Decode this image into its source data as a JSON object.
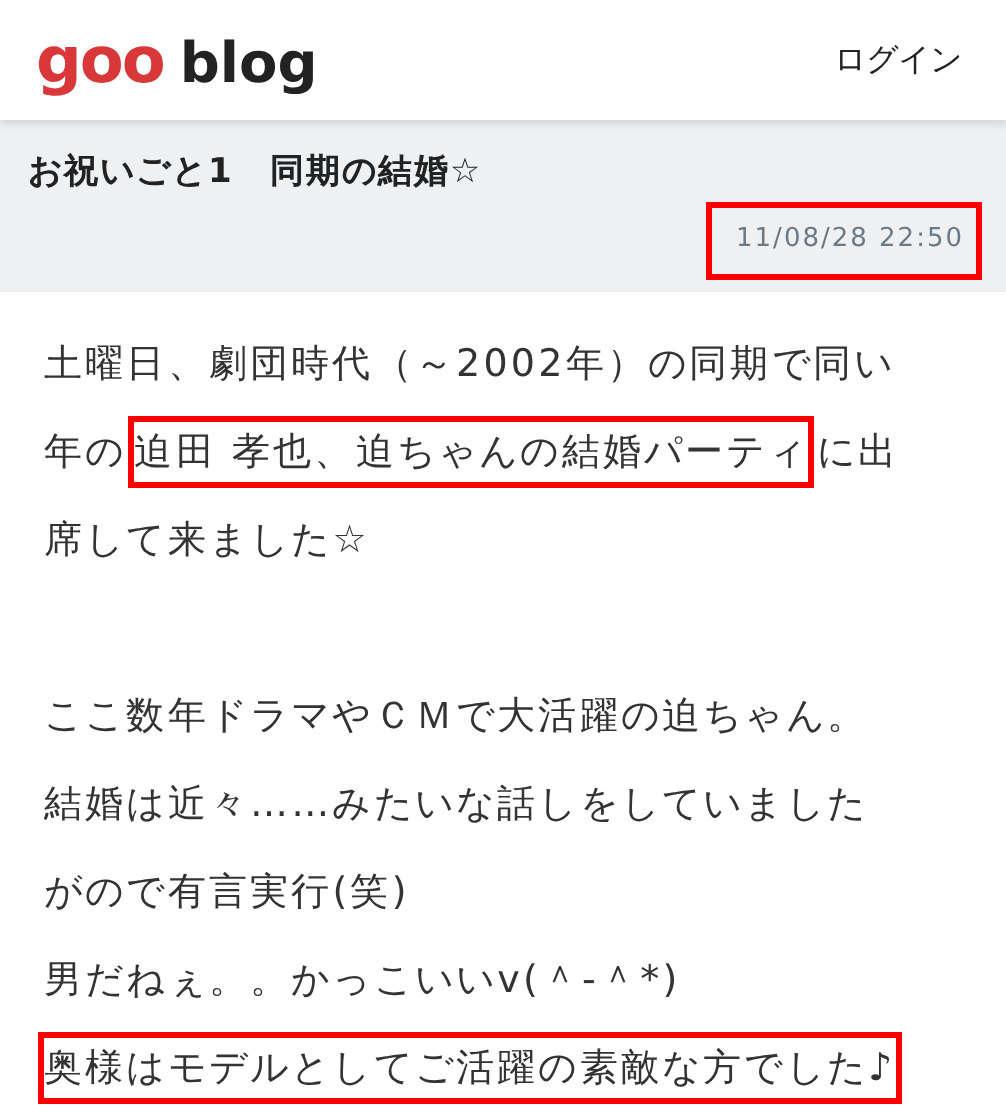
{
  "header": {
    "logo_brand": "goo",
    "logo_product": "blog",
    "login": "ログイン"
  },
  "post": {
    "title": "お祝いごと1　同期の結婚☆",
    "date": {
      "text": "11/08/28 22:50",
      "highlighted": true
    },
    "paragraphs": [
      {
        "lines": [
          [
            {
              "text": "土曜日、劇団時代（～2002年）の同期で同い",
              "highlighted": false
            }
          ],
          [
            {
              "text": "年の",
              "highlighted": false
            },
            {
              "text": "迫田 孝也、迫ちゃんの結婚パーティ",
              "highlighted": true
            },
            {
              "text": "に出",
              "highlighted": false
            }
          ],
          [
            {
              "text": "席して来ました☆",
              "highlighted": false
            }
          ]
        ]
      },
      {
        "lines": [
          [
            {
              "text": "ここ数年ドラマやＣＭで大活躍の迫ちゃん。",
              "highlighted": false
            }
          ],
          [
            {
              "text": "結婚は近々……みたいな話しをしていました",
              "highlighted": false
            }
          ],
          [
            {
              "text": "がので有言実行(笑)",
              "highlighted": false
            }
          ],
          [
            {
              "text": "男だねぇ。。かっこいいv(＾-＾*)",
              "highlighted": false
            }
          ],
          [
            {
              "text": "奥様はモデルとしてご活躍の素敵な方でした♪",
              "highlighted": true
            }
          ]
        ]
      }
    ]
  }
}
